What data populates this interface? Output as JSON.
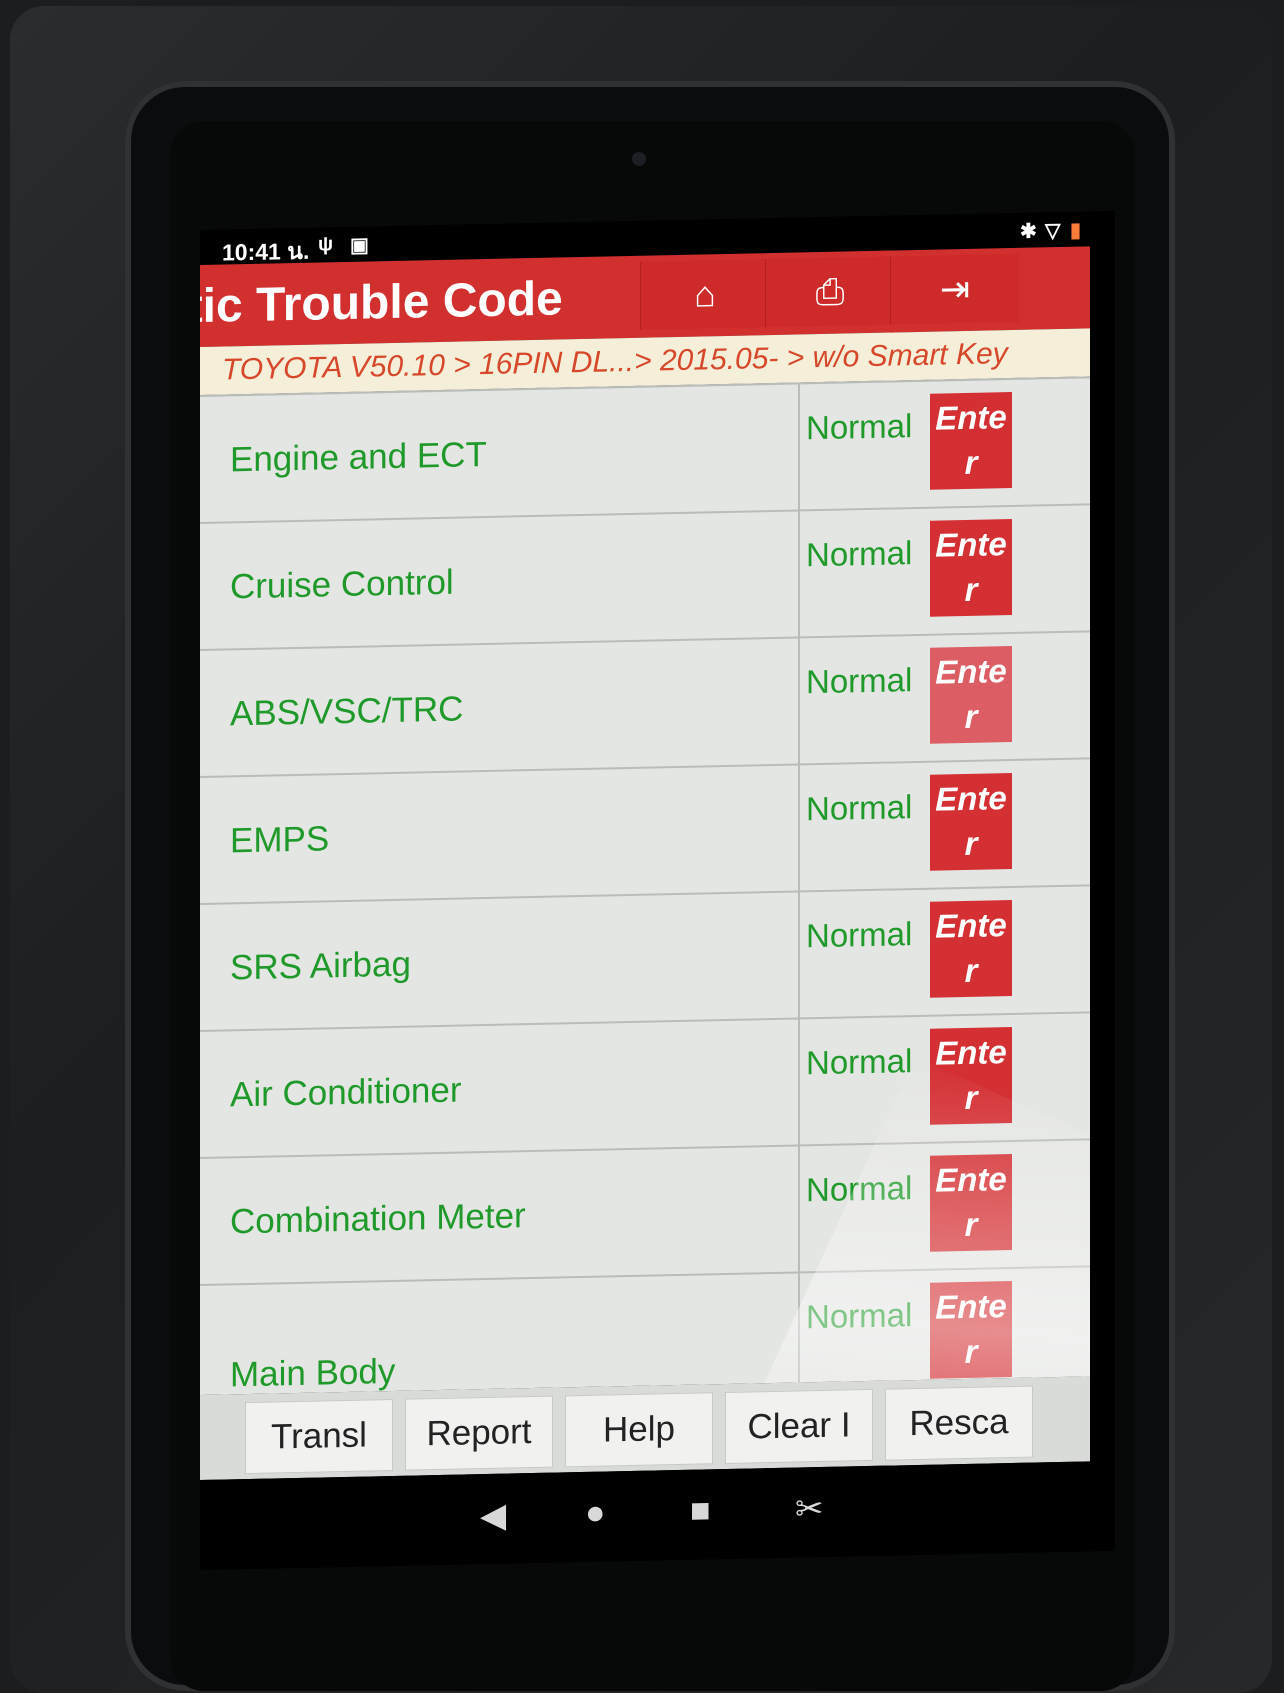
{
  "statusbar": {
    "time": "10:41 น.",
    "left_icons": [
      "usb-debug-icon",
      "image-icon"
    ],
    "right_icons": [
      "bluetooth-icon",
      "wifi-icon",
      "battery-icon"
    ]
  },
  "header": {
    "title": "stic Trouble Code",
    "buttons": [
      {
        "icon": "home-icon",
        "glyph": "⌂"
      },
      {
        "icon": "printer-icon",
        "glyph": "⎙"
      },
      {
        "icon": "exit-icon",
        "glyph": "⇥"
      }
    ]
  },
  "breadcrumb": "TOYOTA V50.10 > 16PIN DL...> 2015.05- > w/o Smart Key",
  "systems": [
    {
      "name": "Engine and ECT",
      "status": "Normal",
      "action": "Enter"
    },
    {
      "name": "Cruise Control",
      "status": "Normal",
      "action": "Enter"
    },
    {
      "name": "ABS/VSC/TRC",
      "status": "Normal",
      "action": "Enter"
    },
    {
      "name": "EMPS",
      "status": "Normal",
      "action": "Enter"
    },
    {
      "name": "SRS Airbag",
      "status": "Normal",
      "action": "Enter"
    },
    {
      "name": "Air Conditioner",
      "status": "Normal",
      "action": "Enter"
    },
    {
      "name": "Combination Meter",
      "status": "Normal",
      "action": "Enter"
    },
    {
      "name": "Main Body",
      "status": "Normal",
      "action": "Enter"
    }
  ],
  "bottom_buttons": [
    "Transl",
    "Report",
    "Help",
    "Clear I",
    "Resca"
  ],
  "navbar": {
    "back": "◀",
    "home": "●",
    "recents": "■",
    "screenshot": "✂"
  }
}
